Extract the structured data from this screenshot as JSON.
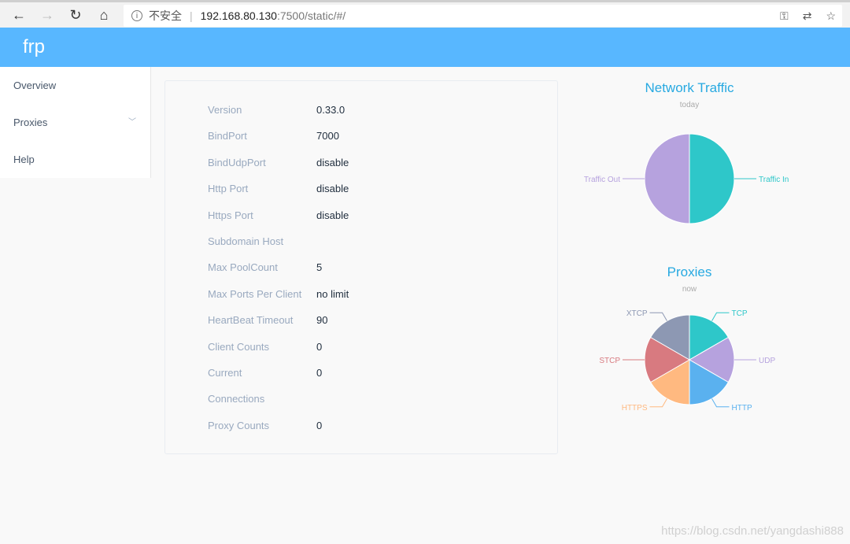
{
  "browser": {
    "insecure_label": "不安全",
    "url_host": "192.168.80.130",
    "url_rest": ":7500/static/#/"
  },
  "app": {
    "title": "frp"
  },
  "sidebar": {
    "items": [
      {
        "label": "Overview"
      },
      {
        "label": "Proxies"
      },
      {
        "label": "Help"
      }
    ]
  },
  "info": [
    {
      "k": "Version",
      "v": "0.33.0"
    },
    {
      "k": "BindPort",
      "v": "7000"
    },
    {
      "k": "BindUdpPort",
      "v": "disable"
    },
    {
      "k": "Http Port",
      "v": "disable"
    },
    {
      "k": "Https Port",
      "v": "disable"
    },
    {
      "k": "Subdomain Host",
      "v": ""
    },
    {
      "k": "Max PoolCount",
      "v": "5"
    },
    {
      "k": "Max Ports Per Client",
      "v": "no limit"
    },
    {
      "k": "HeartBeat Timeout",
      "v": "90"
    },
    {
      "k": "Client Counts",
      "v": "0"
    },
    {
      "k": "Current",
      "v": "0"
    },
    {
      "k": "Connections",
      "v": ""
    },
    {
      "k": "Proxy Counts",
      "v": "0"
    }
  ],
  "chart_data": [
    {
      "type": "pie",
      "title": "Network Traffic",
      "subtitle": "today",
      "categories": [
        "Traffic In",
        "Traffic Out"
      ],
      "colors": [
        "#2ec7c9",
        "#b6a2de"
      ],
      "values": [
        0,
        0
      ]
    },
    {
      "type": "pie",
      "title": "Proxies",
      "subtitle": "now",
      "categories": [
        "TCP",
        "UDP",
        "HTTP",
        "HTTPS",
        "STCP",
        "XTCP"
      ],
      "colors": [
        "#2ec7c9",
        "#b6a2de",
        "#5ab1ef",
        "#ffb980",
        "#d87a80",
        "#8d98b3"
      ],
      "values": [
        0,
        0,
        0,
        0,
        0,
        0
      ]
    }
  ],
  "watermark": "https://blog.csdn.net/yangdashi888"
}
